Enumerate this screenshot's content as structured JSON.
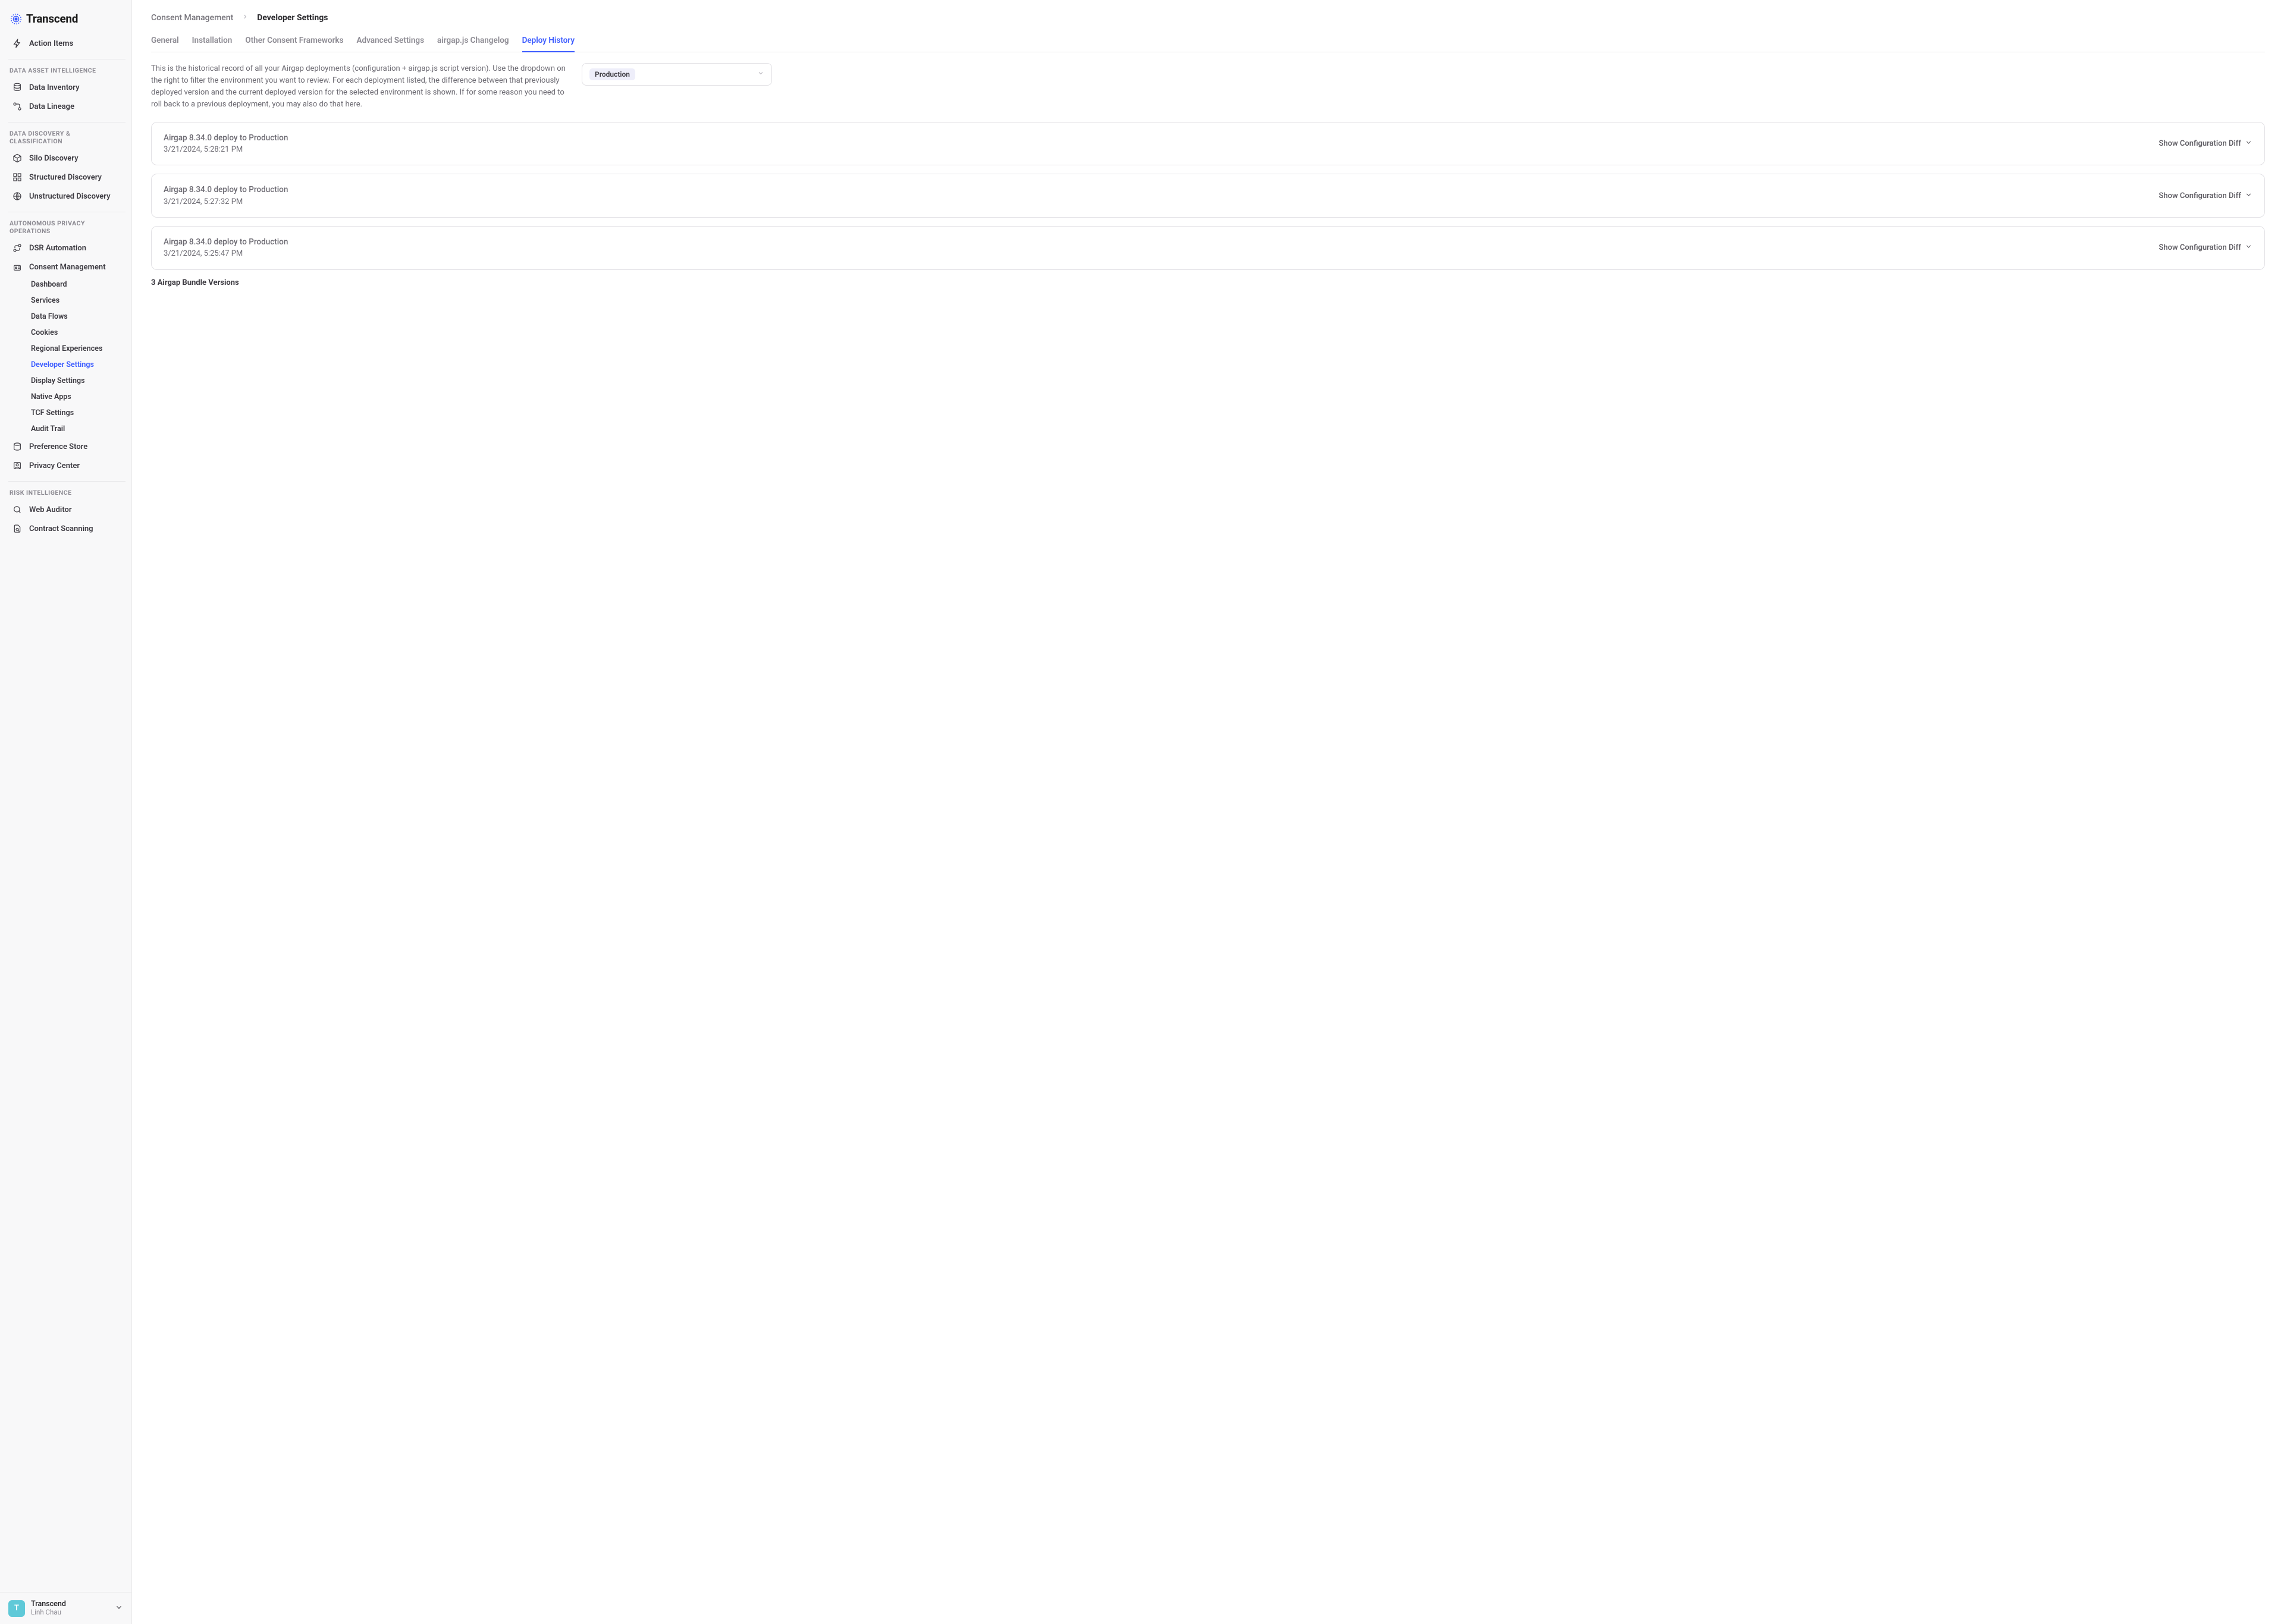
{
  "brand": "Transcend",
  "sidebar": {
    "action_items": "Action Items",
    "sections": [
      {
        "label": "DATA ASSET INTELLIGENCE",
        "items": [
          "Data Inventory",
          "Data Lineage"
        ]
      },
      {
        "label": "DATA DISCOVERY & CLASSIFICATION",
        "items": [
          "Silo Discovery",
          "Structured Discovery",
          "Unstructured Discovery"
        ]
      },
      {
        "label": "AUTONOMOUS PRIVACY OPERATIONS",
        "items": [
          "DSR Automation",
          "Consent Management",
          "Preference Store",
          "Privacy Center"
        ],
        "consent_sub": [
          "Dashboard",
          "Services",
          "Data Flows",
          "Cookies",
          "Regional Experiences",
          "Developer Settings",
          "Display Settings",
          "Native Apps",
          "TCF Settings",
          "Audit Trail"
        ]
      },
      {
        "label": "RISK INTELLIGENCE",
        "items": [
          "Web Auditor",
          "Contract Scanning"
        ]
      }
    ],
    "footer": {
      "org": "Transcend",
      "user": "Linh Chau",
      "avatar": "T"
    }
  },
  "breadcrumb": {
    "parent": "Consent Management",
    "current": "Developer Settings"
  },
  "tabs": [
    "General",
    "Installation",
    "Other Consent Frameworks",
    "Advanced Settings",
    "airgap.js Changelog",
    "Deploy History"
  ],
  "active_tab": "Deploy History",
  "description": "This is the historical record of all your Airgap deployments (configuration + airgap.js script version). Use the dropdown on the right to filter the environment you want to review. For each deployment listed, the difference between that previously deployed version and the current deployed version for the selected environment is shown. If for some reason you need to roll back to a previous deployment, you may also do that here.",
  "env_filter": "Production",
  "diff_label": "Show Configuration Diff",
  "deployments": [
    {
      "title": "Airgap 8.34.0 deploy to Production",
      "date": "3/21/2024, 5:28:21 PM"
    },
    {
      "title": "Airgap 8.34.0 deploy to Production",
      "date": "3/21/2024, 5:27:32 PM"
    },
    {
      "title": "Airgap 8.34.0 deploy to Production",
      "date": "3/21/2024, 5:25:47 PM"
    }
  ],
  "bundle_count": "3 Airgap Bundle Versions"
}
